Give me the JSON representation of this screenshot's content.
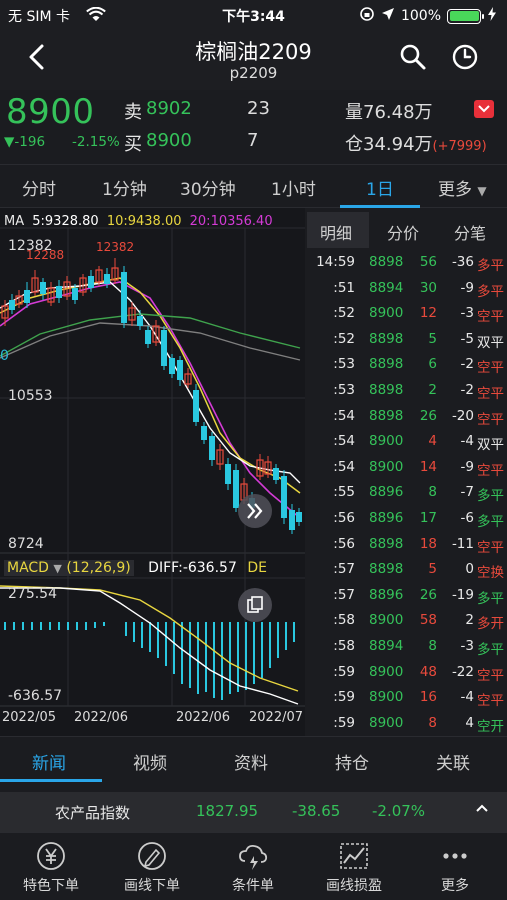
{
  "status_bar": {
    "carrier": "无 SIM 卡",
    "time": "下午3:44",
    "battery": "100%"
  },
  "header": {
    "title": "棕榈油2209",
    "subtitle": "p2209"
  },
  "quote": {
    "last_price": "8900",
    "change": "-196",
    "change_pct": "-2.15%",
    "ask_label": "卖",
    "ask_price": "8902",
    "ask_qty": "23",
    "bid_label": "买",
    "bid_price": "8900",
    "bid_qty": "7",
    "volume_label": "量",
    "volume": "76.48万",
    "oi_label": "仓",
    "oi": "34.94万",
    "oi_change": "(+7999)"
  },
  "period_tabs": [
    "分时",
    "1分钟",
    "30分钟",
    "1小时",
    "1日",
    "更多"
  ],
  "active_period": "1日",
  "ma_legend": {
    "ma_label": "MA",
    "ma5": "5:9328.80",
    "ma10": "10:9438.00",
    "ma20": "20:10356.40"
  },
  "price_axis": {
    "high": "12382",
    "mid": "10553",
    "low": "8724",
    "left_partial": "0"
  },
  "candle_labels": {
    "peak1": "12288",
    "peak2": "12382"
  },
  "macd": {
    "label": "MACD",
    "params": "(12,26,9)",
    "diff": "DIFF:-636.57",
    "dea_partial": "DE",
    "top": "275.54",
    "bottom": "-636.57"
  },
  "date_axis": [
    "2022/05",
    "2022/06",
    "2022/06",
    "2022/07"
  ],
  "colors": {
    "green": "#35c25a",
    "red": "#e84a3c",
    "accent": "#2aa6e8",
    "ma5": "#ffffff",
    "ma10": "#e8d640",
    "ma20": "#d43bd6"
  },
  "tick_tabs": [
    "明细",
    "分价",
    "分笔"
  ],
  "ticks": [
    {
      "time": "14:59",
      "price": "8898",
      "vol": "56",
      "oi": "-36",
      "type": "多平",
      "pc": "green",
      "vc": "green",
      "tc": "red"
    },
    {
      "time": ":51",
      "price": "8894",
      "vol": "30",
      "oi": "-9",
      "type": "多平",
      "pc": "green",
      "vc": "green",
      "tc": "red"
    },
    {
      "time": ":52",
      "price": "8900",
      "vol": "12",
      "oi": "-3",
      "type": "空平",
      "pc": "green",
      "vc": "red",
      "tc": "red"
    },
    {
      "time": ":52",
      "price": "8898",
      "vol": "5",
      "oi": "-5",
      "type": "双平",
      "pc": "green",
      "vc": "green",
      "tc": "white"
    },
    {
      "time": ":53",
      "price": "8898",
      "vol": "6",
      "oi": "-2",
      "type": "空平",
      "pc": "green",
      "vc": "green",
      "tc": "red"
    },
    {
      "time": ":53",
      "price": "8898",
      "vol": "2",
      "oi": "-2",
      "type": "空平",
      "pc": "green",
      "vc": "green",
      "tc": "red"
    },
    {
      "time": ":54",
      "price": "8898",
      "vol": "26",
      "oi": "-20",
      "type": "空平",
      "pc": "green",
      "vc": "green",
      "tc": "red"
    },
    {
      "time": ":54",
      "price": "8900",
      "vol": "4",
      "oi": "-4",
      "type": "双平",
      "pc": "green",
      "vc": "red",
      "tc": "white"
    },
    {
      "time": ":54",
      "price": "8900",
      "vol": "14",
      "oi": "-9",
      "type": "空平",
      "pc": "green",
      "vc": "red",
      "tc": "red"
    },
    {
      "time": ":55",
      "price": "8896",
      "vol": "8",
      "oi": "-7",
      "type": "多平",
      "pc": "green",
      "vc": "green",
      "tc": "green"
    },
    {
      "time": ":56",
      "price": "8896",
      "vol": "17",
      "oi": "-6",
      "type": "多平",
      "pc": "green",
      "vc": "green",
      "tc": "green"
    },
    {
      "time": ":56",
      "price": "8898",
      "vol": "18",
      "oi": "-11",
      "type": "空平",
      "pc": "green",
      "vc": "red",
      "tc": "red"
    },
    {
      "time": ":57",
      "price": "8898",
      "vol": "5",
      "oi": "0",
      "type": "空换",
      "pc": "green",
      "vc": "red",
      "tc": "red"
    },
    {
      "time": ":57",
      "price": "8896",
      "vol": "26",
      "oi": "-19",
      "type": "多平",
      "pc": "green",
      "vc": "green",
      "tc": "green"
    },
    {
      "time": ":58",
      "price": "8900",
      "vol": "58",
      "oi": "2",
      "type": "多开",
      "pc": "green",
      "vc": "red",
      "tc": "red"
    },
    {
      "time": ":58",
      "price": "8894",
      "vol": "8",
      "oi": "-3",
      "type": "多平",
      "pc": "green",
      "vc": "green",
      "tc": "green"
    },
    {
      "time": ":59",
      "price": "8900",
      "vol": "48",
      "oi": "-22",
      "type": "空平",
      "pc": "green",
      "vc": "red",
      "tc": "red"
    },
    {
      "time": ":59",
      "price": "8900",
      "vol": "16",
      "oi": "-4",
      "type": "空平",
      "pc": "green",
      "vc": "red",
      "tc": "red"
    },
    {
      "time": ":59",
      "price": "8900",
      "vol": "8",
      "oi": "4",
      "type": "空开",
      "pc": "green",
      "vc": "red",
      "tc": "green"
    }
  ],
  "bottom_tabs": [
    "新闻",
    "视频",
    "资料",
    "持仓",
    "关联"
  ],
  "index_bar": {
    "name": "农产品指数",
    "value": "1827.95",
    "change": "-38.65",
    "pct": "-2.07%"
  },
  "toolbar": [
    "特色下单",
    "画线下单",
    "条件单",
    "画线损盈",
    "更多"
  ]
}
